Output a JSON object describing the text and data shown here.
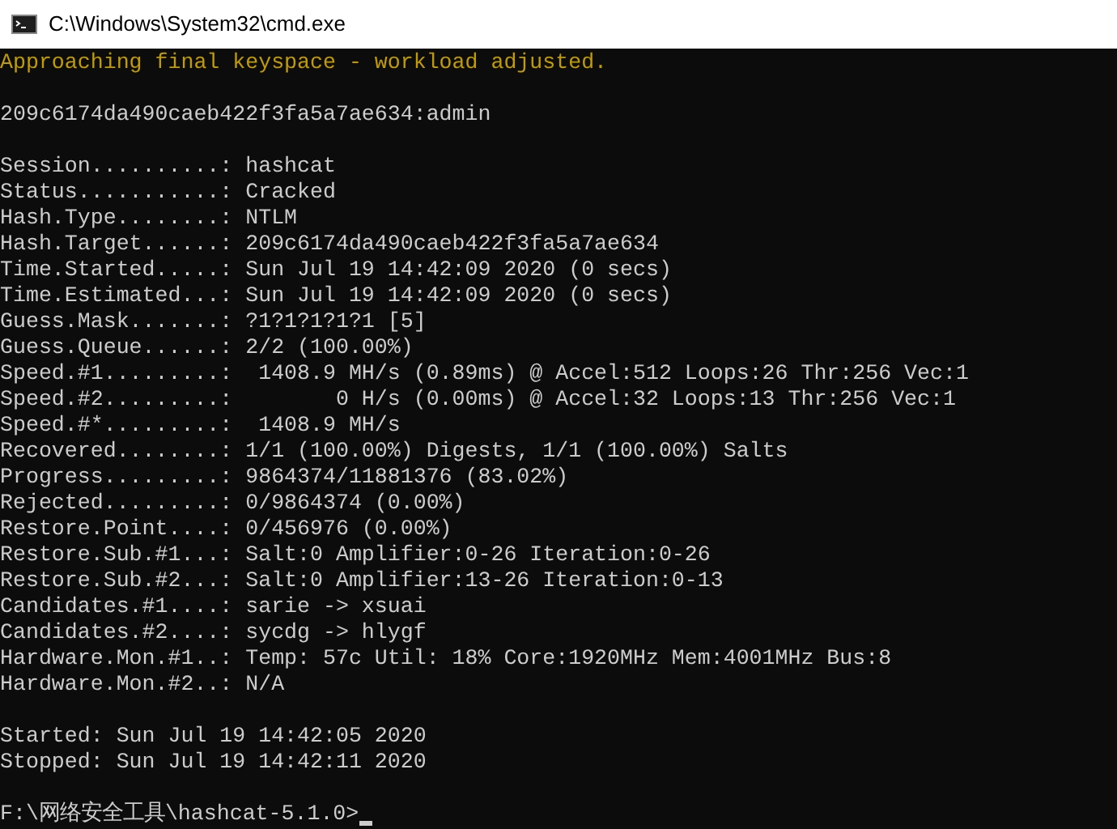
{
  "window": {
    "title": "C:\\Windows\\System32\\cmd.exe"
  },
  "console": {
    "lines": [
      {
        "kind": "warning",
        "text": "Approaching final keyspace - workload adjusted."
      },
      {
        "kind": "blank"
      },
      {
        "kind": "output",
        "text": "209c6174da490caeb422f3fa5a7ae634:admin"
      },
      {
        "kind": "blank"
      },
      {
        "kind": "output",
        "text": "Session..........: hashcat"
      },
      {
        "kind": "output",
        "text": "Status...........: Cracked"
      },
      {
        "kind": "output",
        "text": "Hash.Type........: NTLM"
      },
      {
        "kind": "output",
        "text": "Hash.Target......: 209c6174da490caeb422f3fa5a7ae634"
      },
      {
        "kind": "output",
        "text": "Time.Started.....: Sun Jul 19 14:42:09 2020 (0 secs)"
      },
      {
        "kind": "output",
        "text": "Time.Estimated...: Sun Jul 19 14:42:09 2020 (0 secs)"
      },
      {
        "kind": "output",
        "text": "Guess.Mask.......: ?1?1?1?1?1 [5]"
      },
      {
        "kind": "output",
        "text": "Guess.Queue......: 2/2 (100.00%)"
      },
      {
        "kind": "output",
        "text": "Speed.#1.........:  1408.9 MH/s (0.89ms) @ Accel:512 Loops:26 Thr:256 Vec:1"
      },
      {
        "kind": "output",
        "text": "Speed.#2.........:        0 H/s (0.00ms) @ Accel:32 Loops:13 Thr:256 Vec:1"
      },
      {
        "kind": "output",
        "text": "Speed.#*.........:  1408.9 MH/s"
      },
      {
        "kind": "output",
        "text": "Recovered........: 1/1 (100.00%) Digests, 1/1 (100.00%) Salts"
      },
      {
        "kind": "output",
        "text": "Progress.........: 9864374/11881376 (83.02%)"
      },
      {
        "kind": "output",
        "text": "Rejected.........: 0/9864374 (0.00%)"
      },
      {
        "kind": "output",
        "text": "Restore.Point....: 0/456976 (0.00%)"
      },
      {
        "kind": "output",
        "text": "Restore.Sub.#1...: Salt:0 Amplifier:0-26 Iteration:0-26"
      },
      {
        "kind": "output",
        "text": "Restore.Sub.#2...: Salt:0 Amplifier:13-26 Iteration:0-13"
      },
      {
        "kind": "output",
        "text": "Candidates.#1....: sarie -> xsuai"
      },
      {
        "kind": "output",
        "text": "Candidates.#2....: sycdg -> hlygf"
      },
      {
        "kind": "output",
        "text": "Hardware.Mon.#1..: Temp: 57c Util: 18% Core:1920MHz Mem:4001MHz Bus:8"
      },
      {
        "kind": "output",
        "text": "Hardware.Mon.#2..: N/A"
      },
      {
        "kind": "blank"
      },
      {
        "kind": "output",
        "text": "Started: Sun Jul 19 14:42:05 2020"
      },
      {
        "kind": "output",
        "text": "Stopped: Sun Jul 19 14:42:11 2020"
      },
      {
        "kind": "blank"
      },
      {
        "kind": "prompt",
        "text": "F:\\网络安全工具\\hashcat-5.1.0>"
      }
    ]
  }
}
